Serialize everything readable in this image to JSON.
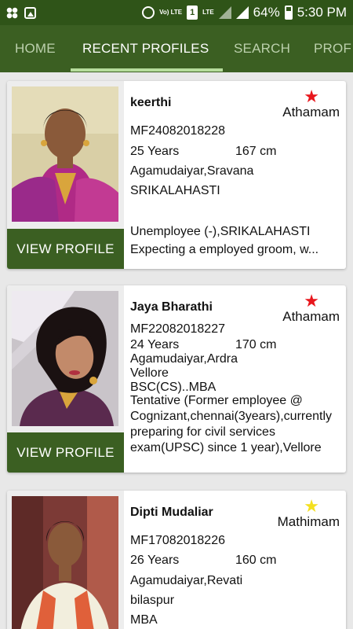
{
  "status_bar": {
    "volte": "Vo) LTE",
    "sim": "1",
    "lte": "LTE",
    "battery": "64%",
    "time": "5:30 PM"
  },
  "tabs": [
    {
      "label": "HOME",
      "active": false
    },
    {
      "label": "RECENT PROFILES",
      "active": true
    },
    {
      "label": "SEARCH",
      "active": false
    },
    {
      "label": "PROF",
      "active": false
    }
  ],
  "view_profile_label": "VIEW PROFILE",
  "profiles": [
    {
      "name": "keerthi",
      "star": "Athamam",
      "star_color": "#e8161c",
      "id": "MF24082018228",
      "age": "25 Years",
      "height": "167 cm",
      "caste": "Agamudaiyar,Sravana",
      "location": "SRIKALAHASTI",
      "occupation": "Unemployee (-),SRIKALAHASTI",
      "expectation": "Expecting a employed groom, w..."
    },
    {
      "name": "Jaya Bharathi",
      "star": "Athamam",
      "star_color": "#e8161c",
      "id": "MF22082018227",
      "age": "24 Years",
      "height": "170 cm",
      "caste": "Agamudaiyar,Ardra",
      "location": "Vellore",
      "education": "BSC(CS)..MBA",
      "occupation": "Tentative (Former employee @ Cognizant,chennai(3years),currently preparing for civil services exam(UPSC) since 1 year),Vellore"
    },
    {
      "name": "Dipti Mudaliar",
      "star": "Mathimam",
      "star_color": "#f4e01f",
      "id": "MF17082018226",
      "age": "26 Years",
      "height": "160 cm",
      "caste": "Agamudaiyar,Revati",
      "location": "bilaspur",
      "education": "MBA"
    }
  ]
}
